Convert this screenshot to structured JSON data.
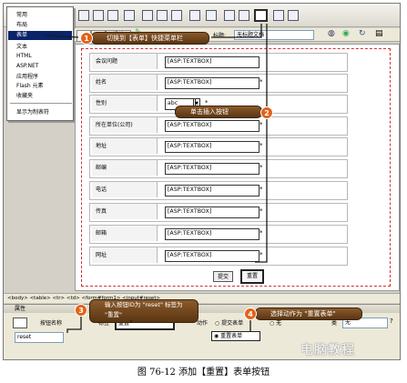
{
  "insert_menu": {
    "items": [
      "常用",
      "布局",
      "表单",
      "文本",
      "HTML",
      "ASP.NET",
      "应用程序",
      "Flash 元素",
      "收藏夹",
      "显示为制表符"
    ],
    "active_index": 2
  },
  "doc_toolbar": {
    "design_label": "设计",
    "title_label": "标题:",
    "title_value": "无标题文档"
  },
  "callouts": {
    "c1": {
      "num": "1",
      "text": "切换到【表单】快捷菜单栏"
    },
    "c2": {
      "num": "2",
      "text": "单击插入按钮"
    },
    "c3": {
      "num": "3",
      "text": "输入按钮ID为 \"reset\" 标签为 \"重置\""
    },
    "c4": {
      "num": "4",
      "text": "选择动作为 \"重置表单\""
    }
  },
  "form": {
    "rows": [
      {
        "label": "会议问题",
        "value": "[ASP:TEXTBOX]",
        "star": ""
      },
      {
        "label": "姓名",
        "value": "[ASP:TEXTBOX]",
        "star": "*"
      },
      {
        "label": "性别",
        "value": "abc",
        "star": "*"
      },
      {
        "label": "所在单位(公司)",
        "value": "[ASP:TEXTBOX]",
        "star": "*"
      },
      {
        "label": "地址",
        "value": "[ASP:TEXTBOX]",
        "star": "*"
      },
      {
        "label": "邮编",
        "value": "[ASP:TEXTBOX]",
        "star": "*"
      },
      {
        "label": "电话",
        "value": "[ASP:TEXTBOX]",
        "star": "*"
      },
      {
        "label": "传真",
        "value": "[ASP:TEXTBOX]",
        "star": "*"
      },
      {
        "label": "邮箱",
        "value": "[ASP:TEXTBOX]",
        "star": "*"
      },
      {
        "label": "网址",
        "value": "[ASP:TEXTBOX]",
        "star": "*"
      }
    ],
    "submit_label": "提交",
    "reset_label": "重置"
  },
  "tag_selector": "<body> <table> <tr> <td> <form#form1> <input#reset>",
  "properties": {
    "header": "属性",
    "button_name_label": "按钮名称",
    "button_name_value": "reset",
    "label_label": "标签",
    "label_value": "重置",
    "action_label": "动作",
    "action_submit": "提交表单",
    "action_none": "无",
    "action_reset": "重置表单",
    "class_label": "类",
    "class_value": "无"
  },
  "caption": "图 76-12   添加【重置】表单按钮",
  "watermark": "电脑教程"
}
